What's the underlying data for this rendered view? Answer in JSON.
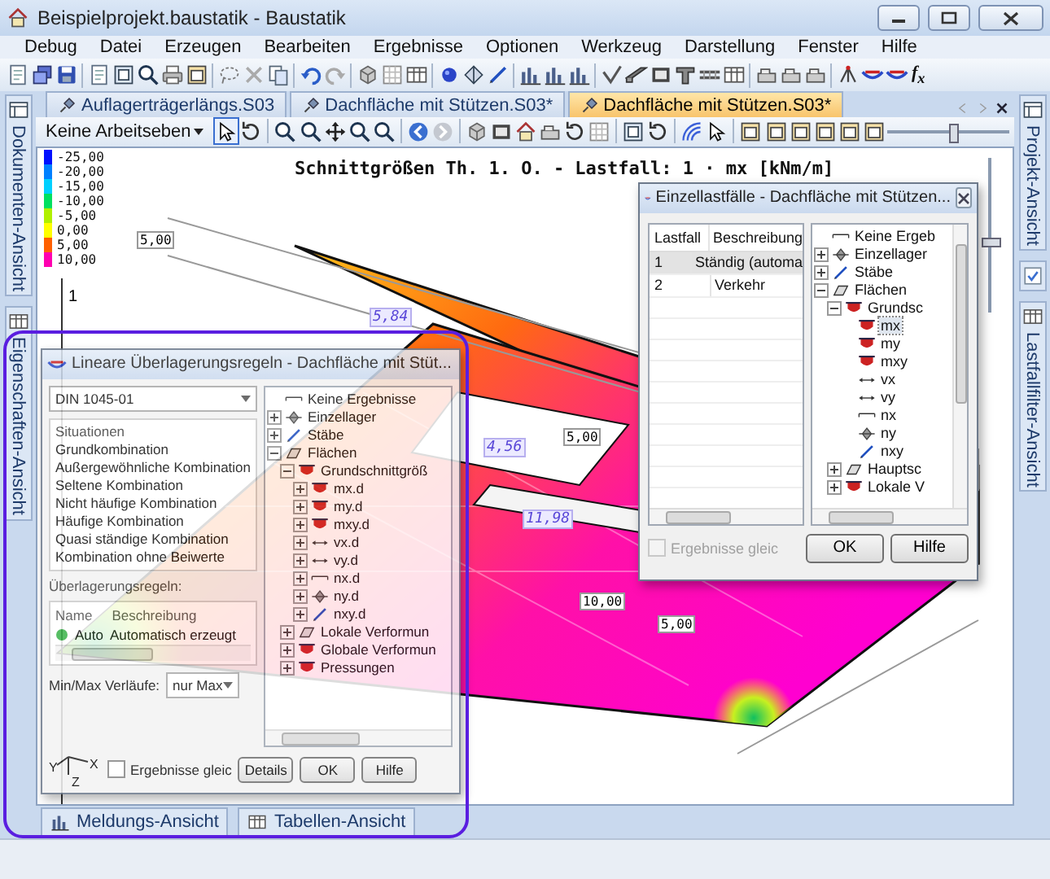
{
  "window": {
    "title": "Beispielprojekt.baustatik - Baustatik"
  },
  "menu": [
    "Debug",
    "Datei",
    "Erzeugen",
    "Bearbeiten",
    "Ergebnisse",
    "Optionen",
    "Werkzeug",
    "Darstellung",
    "Fenster",
    "Hilfe"
  ],
  "toolbar": {
    "function_button": "f$_{x}$"
  },
  "left_dock": [
    {
      "label": "Dokumenten-Ansicht"
    },
    {
      "label": "Eigenschaften-Ansicht"
    }
  ],
  "right_dock": [
    {
      "label": "Projekt-Ansicht"
    },
    {
      "label": "Lastfallfilter-Ansicht"
    }
  ],
  "document_tabs": [
    {
      "label": "Auflagerträgerlängs.S03",
      "selected": false
    },
    {
      "label": "Dachfläche mit Stützen.S03*",
      "selected": false
    },
    {
      "label": "Dachfläche mit Stützen.S03*",
      "selected": true
    }
  ],
  "view_toolbar": {
    "workplane": "Keine Arbeitseben",
    "pointer_tool": {
      "selected": true
    },
    "zoom_slider": {
      "level": 0.55
    }
  },
  "canvas": {
    "title": "Schnittgrößen Th. 1. O. - Lastfall: 1 · mx [kNm/m]",
    "legend": [
      {
        "value": "-25,00",
        "color": "#0010ff"
      },
      {
        "value": "-20,00",
        "color": "#0080ff"
      },
      {
        "value": "-15,00",
        "color": "#00d0ff"
      },
      {
        "value": "-10,00",
        "color": "#00e060"
      },
      {
        "value": "-5,00",
        "color": "#b0f000"
      },
      {
        "value": "0,00",
        "color": "#ffff00"
      },
      {
        "value": "5,00",
        "color": "#ff6000"
      },
      {
        "value": "10,00",
        "color": "#ff00b0"
      }
    ],
    "axis_label": "1",
    "value_labels": [
      {
        "text": "5,84",
        "kind": "extreme"
      },
      {
        "text": "4,56",
        "kind": "extreme"
      },
      {
        "text": "11,98",
        "kind": "extreme"
      },
      {
        "text": "5,00",
        "kind": "contour"
      },
      {
        "text": "10,00",
        "kind": "contour"
      },
      {
        "text": "5,00",
        "kind": "contour"
      },
      {
        "text": "5,00",
        "kind": "contour"
      }
    ],
    "side_slider": {
      "level": 0.45
    }
  },
  "load_case_dialog": {
    "title": "Einzellastfälle - Dachfläche mit Stützen...",
    "columns": [
      "Lastfall",
      "Beschreibung"
    ],
    "rows": [
      {
        "cells": [
          "1",
          "Ständig (automa"
        ],
        "selected": true
      },
      {
        "cells": [
          "2",
          "Verkehr"
        ],
        "selected": false
      }
    ],
    "tree": [
      {
        "label": "Keine Ergeb",
        "selected": false
      },
      {
        "label": "Einzellager",
        "expanded": false,
        "selected": false
      },
      {
        "label": "Stäbe",
        "expanded": false,
        "selected": false
      },
      {
        "label": "Flächen",
        "expanded": true,
        "selected": false,
        "children": [
          {
            "label": "Grundsc",
            "expanded": true,
            "selected": false,
            "children": [
              {
                "label": "mx",
                "selected": true
              },
              {
                "label": "my",
                "selected": false
              },
              {
                "label": "mxy",
                "selected": false
              },
              {
                "label": "vx",
                "selected": false
              },
              {
                "label": "vy",
                "selected": false
              },
              {
                "label": "nx",
                "selected": false
              },
              {
                "label": "ny",
                "selected": false
              },
              {
                "label": "nxy",
                "selected": false
              }
            ]
          },
          {
            "label": "Hauptsc",
            "expanded": false,
            "selected": false
          },
          {
            "label": "Lokale V",
            "expanded": false,
            "selected": false
          }
        ]
      }
    ],
    "checkbox": {
      "label": "Ergebnisse gleic",
      "checked": false,
      "disabled": true
    },
    "buttons": [
      "OK",
      "Hilfe"
    ]
  },
  "superposition_dialog": {
    "title": "Lineare Überlagerungsregeln - Dachfläche mit Stüt...",
    "norm": "DIN 1045-01",
    "situations_label": "Situationen",
    "situations": [
      "Grundkombination",
      "Außergewöhnliche Kombination",
      "Seltene Kombination",
      "Nicht häufige Kombination",
      "Häufige Kombination",
      "Quasi ständige Kombination",
      "Kombination ohne Beiwerte"
    ],
    "tree": [
      {
        "label": "Keine Ergebnisse",
        "selected": false
      },
      {
        "label": "Einzellager",
        "expanded": false,
        "selected": false
      },
      {
        "label": "Stäbe",
        "expanded": false,
        "selected": false
      },
      {
        "label": "Flächen",
        "expanded": true,
        "selected": false,
        "children": [
          {
            "label": "Grundschnittgröß",
            "expanded": true,
            "selected": false,
            "children": [
              {
                "label": "mx.d",
                "expanded": false,
                "selected": false
              },
              {
                "label": "my.d",
                "expanded": false,
                "selected": false
              },
              {
                "label": "mxy.d",
                "expanded": false,
                "selected": false
              },
              {
                "label": "vx.d",
                "expanded": false,
                "selected": false
              },
              {
                "label": "vy.d",
                "expanded": false,
                "selected": false
              },
              {
                "label": "nx.d",
                "expanded": false,
                "selected": false
              },
              {
                "label": "ny.d",
                "expanded": false,
                "selected": false
              },
              {
                "label": "nxy.d",
                "expanded": false,
                "selected": false
              }
            ]
          },
          {
            "label": "Lokale Verformun",
            "expanded": false,
            "selected": false
          },
          {
            "label": "Globale Verformun",
            "expanded": false,
            "selected": false
          },
          {
            "label": "Pressungen",
            "expanded": false,
            "selected": false
          }
        ]
      }
    ],
    "rules_label": "Überlagerungsregeln:",
    "rules_columns": [
      "Name",
      "Beschreibung"
    ],
    "rules_rows": [
      {
        "name": "Auto",
        "description": "Automatisch erzeugt"
      }
    ],
    "minmax_label": "Min/Max Verläufe:",
    "minmax_value": "nur Max",
    "axes": [
      "Y",
      "X",
      "Z"
    ],
    "checkbox": {
      "label": "Ergebnisse gleic",
      "checked": false
    },
    "buttons": [
      "Details",
      "OK",
      "Hilfe"
    ]
  },
  "bottom_tabs": [
    "Meldungs-Ansicht",
    "Tabellen-Ansicht"
  ]
}
